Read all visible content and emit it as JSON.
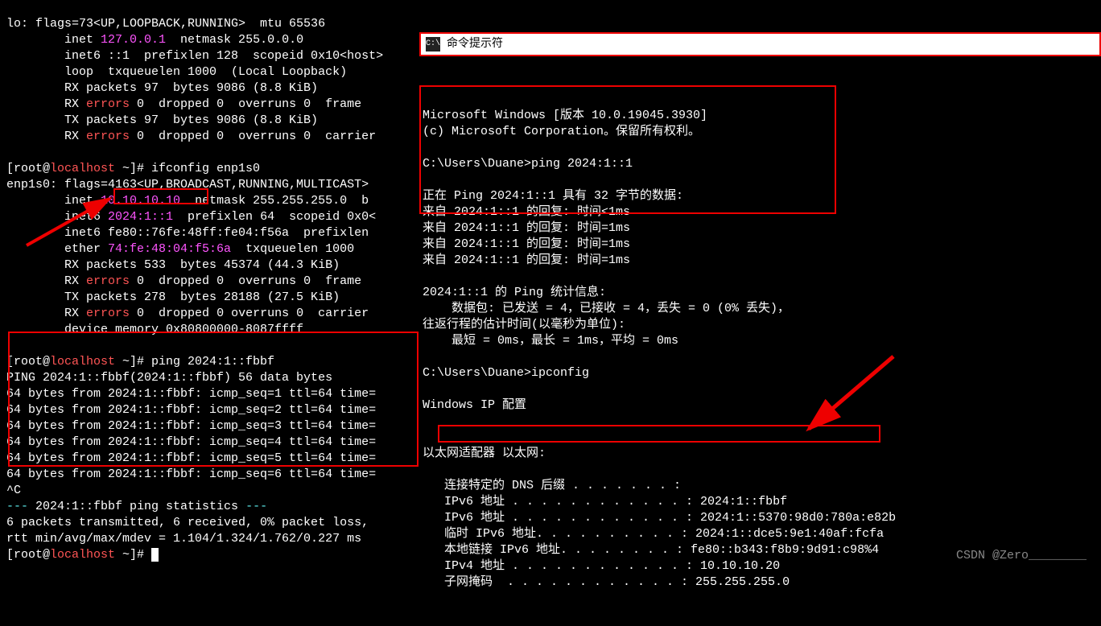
{
  "left": {
    "lo_header": "lo: flags=73<UP,LOOPBACK,RUNNING>  mtu 65536",
    "lo_inet": "        inet ",
    "lo_inet_ip": "127.0.0.1",
    "lo_inet_rest": "  netmask 255.0.0.0",
    "lo_inet6": "        inet6 ::1  prefixlen 128  scopeid 0x10<host>",
    "lo_loop": "        loop  txqueuelen 1000  (Local Loopback)",
    "lo_rx": "        RX packets 97  bytes 9086 (8.8 KiB)",
    "lo_rxerr_pre": "        RX ",
    "lo_err": "errors",
    "lo_rxerr_post": " 0  dropped 0  overruns 0  frame ",
    "lo_tx": "        TX packets 97  bytes 9086 (8.8 KiB)",
    "lo_txerr_post": " 0  dropped 0  overruns 0  carrier",
    "prompt1_pre": "[root@",
    "prompt1_host": "localhost",
    "prompt1_post": " ~]# ifconfig enp1s0",
    "enp_header": "enp1s0: flags=4163<UP,BROADCAST,RUNNING,MULTICAST>",
    "enp_inet_pre": "        inet ",
    "enp_inet_ip": "10.10.10.10",
    "enp_inet_rest": "  netmask 255.255.255.0  b",
    "enp_inet6_pre": "        inet6 ",
    "enp_inet6_ip": "2024:1::1",
    "enp_inet6_rest": "  prefixlen 64  scopeid 0x0<",
    "enp_inet6b": "        inet6 fe80::76fe:48ff:fe04:f56a  prefixlen",
    "enp_ether_pre": "        ether ",
    "enp_ether_mac": "74:fe:48:04:f5:6a",
    "enp_ether_rest": "  txqueuelen 1000",
    "enp_rx": "        RX packets 533  bytes 45374 (44.3 KiB)",
    "enp_rxerr_post": " 0  dropped 0  overruns 0  frame ",
    "enp_tx": "        TX packets 278  bytes 28188 (27.5 KiB)",
    "enp_txerr_post": " 0  dropped 0 overruns 0  carrier",
    "enp_dev": "        device memory 0x80800000-8087ffff",
    "prompt2_post": " ~]# ping 2024:1::fbbf",
    "ping_hdr": "PING 2024:1::fbbf(2024:1::fbbf) 56 data bytes",
    "ping1": "64 bytes from 2024:1::fbbf: icmp_seq=1 ttl=64 time=",
    "ping2": "64 bytes from 2024:1::fbbf: icmp_seq=2 ttl=64 time=",
    "ping3": "64 bytes from 2024:1::fbbf: icmp_seq=3 ttl=64 time=",
    "ping4": "64 bytes from 2024:1::fbbf: icmp_seq=4 ttl=64 time=",
    "ping5": "64 bytes from 2024:1::fbbf: icmp_seq=5 ttl=64 time=",
    "ping6": "64 bytes from 2024:1::fbbf: icmp_seq=6 ttl=64 time=",
    "ctrlc": "^C",
    "stats_dash_pre": "--- ",
    "stats_dash_mid": "2024:1::fbbf ping statistics",
    "stats_dash_post": " ---",
    "stats1": "6 packets transmitted, 6 received, 0% packet loss,",
    "stats2": "rtt min/avg/max/mdev = 1.104/1.324/1.762/0.227 ms",
    "prompt3_post": " ~]# "
  },
  "right": {
    "title": "命令提示符",
    "ms1": "Microsoft Windows [版本 10.0.19045.3930]",
    "ms2": "(c) Microsoft Corporation。保留所有权利。",
    "cmd1": "C:\\Users\\Duane>ping 2024:1::1",
    "ping_hdr": "正在 Ping 2024:1::1 具有 32 字节的数据:",
    "reply1": "来自 2024:1::1 的回复: 时间<1ms",
    "reply2": "来自 2024:1::1 的回复: 时间=1ms",
    "reply3": "来自 2024:1::1 的回复: 时间=1ms",
    "reply4": "来自 2024:1::1 的回复: 时间=1ms",
    "stats1": "2024:1::1 的 Ping 统计信息:",
    "stats2": "    数据包: 已发送 = 4，已接收 = 4，丢失 = 0 (0% 丢失)，",
    "stats3": "往返行程的估计时间(以毫秒为单位):",
    "stats4": "    最短 = 0ms，最长 = 1ms，平均 = 0ms",
    "cmd2": "C:\\Users\\Duane>ipconfig",
    "ipcfg_hdr": "Windows IP 配置",
    "adapter": "以太网适配器 以太网:",
    "dns": "   连接特定的 DNS 后缀 . . . . . . . :",
    "ipv6a": "   IPv6 地址 . . . . . . . . . . . . : 2024:1::fbbf",
    "ipv6b": "   IPv6 地址 . . . . . . . . . . . . : 2024:1::5370:98d0:780a:e82b",
    "tmp6": "   临时 IPv6 地址. . . . . . . . . . : 2024:1::dce5:9e1:40af:fcfa",
    "ll6": "   本地链接 IPv6 地址. . . . . . . . : fe80::b343:f8b9:9d91:c98%4",
    "ipv4": "   IPv4 地址 . . . . . . . . . . . . : 10.10.10.20",
    "mask": "   子网掩码  . . . . . . . . . . . . : 255.255.255.0"
  },
  "watermark": "CSDN @Zero________"
}
